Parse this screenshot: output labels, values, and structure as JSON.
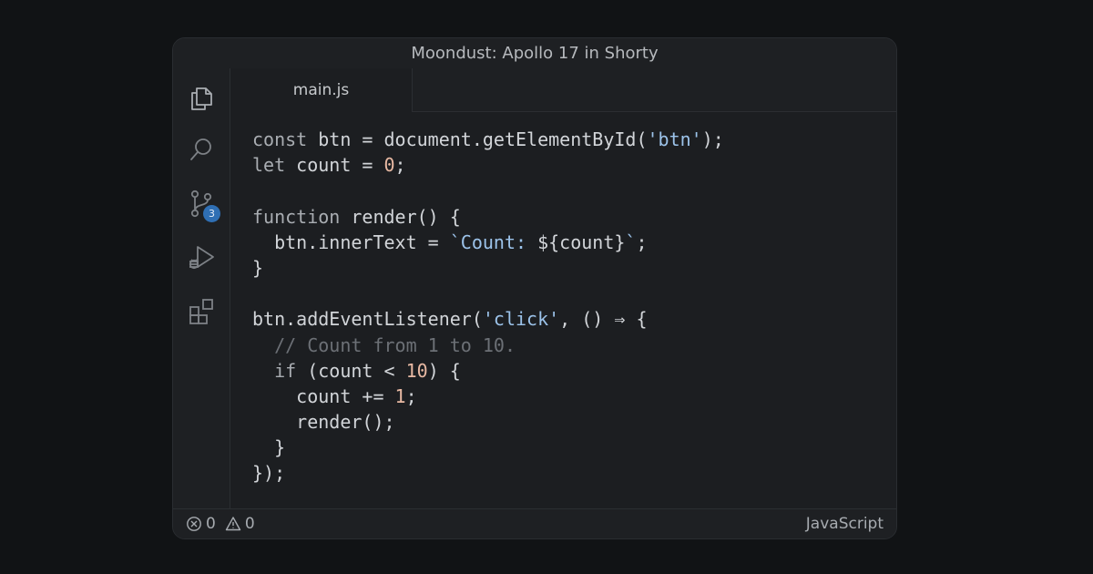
{
  "window": {
    "title": "Moondust: Apollo 17 in Shorty"
  },
  "activity_bar": {
    "items": [
      {
        "icon": "files-icon"
      },
      {
        "icon": "search-icon"
      },
      {
        "icon": "source-control-icon",
        "badge": "3"
      },
      {
        "icon": "run-debug-icon"
      },
      {
        "icon": "extensions-icon"
      }
    ]
  },
  "tabs": [
    {
      "label": "main.js",
      "active": true
    }
  ],
  "editor": {
    "language": "JavaScript",
    "lines": [
      [
        {
          "t": "kw",
          "v": "const"
        },
        {
          "t": "p",
          "v": " btn = document.getElementById("
        },
        {
          "t": "str",
          "v": "'btn'"
        },
        {
          "t": "p",
          "v": ");"
        }
      ],
      [
        {
          "t": "kw",
          "v": "let"
        },
        {
          "t": "p",
          "v": " count = "
        },
        {
          "t": "num",
          "v": "0"
        },
        {
          "t": "p",
          "v": ";"
        }
      ],
      [],
      [
        {
          "t": "kw",
          "v": "function"
        },
        {
          "t": "p",
          "v": " render() {"
        }
      ],
      [
        {
          "t": "p",
          "v": "  btn.innerText = "
        },
        {
          "t": "str",
          "v": "`Count: "
        },
        {
          "t": "p",
          "v": "${count}"
        },
        {
          "t": "str",
          "v": "`"
        },
        {
          "t": "p",
          "v": ";"
        }
      ],
      [
        {
          "t": "p",
          "v": "}"
        }
      ],
      [],
      [
        {
          "t": "p",
          "v": "btn.addEventListener("
        },
        {
          "t": "str",
          "v": "'click'"
        },
        {
          "t": "p",
          "v": ", () ⇒ {"
        }
      ],
      [
        {
          "t": "cm",
          "v": "  // Count from 1 to 10."
        }
      ],
      [
        {
          "t": "kw",
          "v": "  if"
        },
        {
          "t": "p",
          "v": " (count < "
        },
        {
          "t": "num",
          "v": "10"
        },
        {
          "t": "p",
          "v": ") {"
        }
      ],
      [
        {
          "t": "p",
          "v": "    count += "
        },
        {
          "t": "num",
          "v": "1"
        },
        {
          "t": "p",
          "v": ";"
        }
      ],
      [
        {
          "t": "p",
          "v": "    render();"
        }
      ],
      [
        {
          "t": "p",
          "v": "  }"
        }
      ],
      [
        {
          "t": "p",
          "v": "});"
        }
      ]
    ]
  },
  "status": {
    "errors": "0",
    "warnings": "0",
    "language": "JavaScript"
  },
  "colors": {
    "background": "#111315",
    "window": "#1c1e21",
    "badge": "#2f6fb4",
    "string": "#9cc3ea",
    "number": "#e8b9a3",
    "comment": "#6c7076"
  }
}
